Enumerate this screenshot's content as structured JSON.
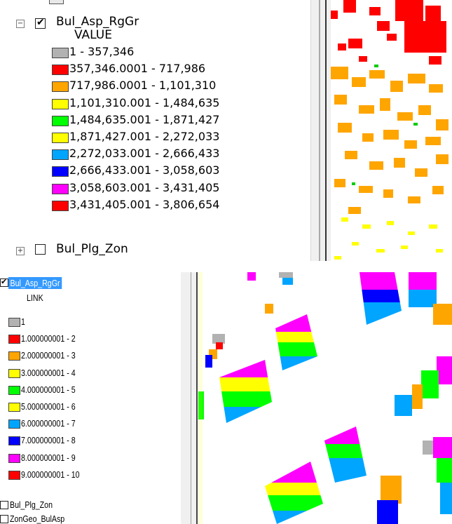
{
  "top": {
    "layer_name": "Bul_Asp_RgGr",
    "field_name": "VALUE",
    "next_layer_name": "Bul_Plg_Zon",
    "expander_collapse": "−",
    "expander_expand": "+",
    "checkmark": "✔",
    "classes": [
      {
        "label": "1 - 357,346",
        "color": "#b2b2b2"
      },
      {
        "label": "357,346.0001 - 717,986",
        "color": "#ff0000"
      },
      {
        "label": "717,986.0001 - 1,101,310",
        "color": "#ffa500"
      },
      {
        "label": "1,101,310.001 - 1,484,635",
        "color": "#ffff00"
      },
      {
        "label": "1,484,635.001 - 1,871,427",
        "color": "#00ff00"
      },
      {
        "label": "1,871,427.001 - 2,272,033",
        "color": "#ffff00"
      },
      {
        "label": "2,272,033.001 - 2,666,433",
        "color": "#00a5ff"
      },
      {
        "label": "2,666,433.001 - 3,058,603",
        "color": "#0000ff"
      },
      {
        "label": "3,058,603.001 - 3,431,405",
        "color": "#ff00ff"
      },
      {
        "label": "3,431,405.001 - 3,806,654",
        "color": "#ff0000"
      }
    ]
  },
  "bottom": {
    "layer_name": "Bul_Asp_RgGr",
    "field_name": "LINK",
    "checkmark": "✔",
    "next_layers": [
      "Bul_Plg_Zon",
      "ZonGeo_BulAsp"
    ],
    "classes": [
      {
        "label": "1",
        "color": "#b2b2b2"
      },
      {
        "label": "1.000000001 - 2",
        "color": "#ff0000"
      },
      {
        "label": "2.000000001 - 3",
        "color": "#ffa500"
      },
      {
        "label": "3.000000001 - 4",
        "color": "#ffff00"
      },
      {
        "label": "4.000000001 - 5",
        "color": "#00ff00"
      },
      {
        "label": "5.000000001 - 6",
        "color": "#ffff00"
      },
      {
        "label": "6.000000001 - 7",
        "color": "#00a5ff"
      },
      {
        "label": "7.000000001 - 8",
        "color": "#0000ff"
      },
      {
        "label": "8.000000001 - 9",
        "color": "#ff00ff"
      },
      {
        "label": "9.000000001 - 10",
        "color": "#ff0000"
      }
    ]
  }
}
